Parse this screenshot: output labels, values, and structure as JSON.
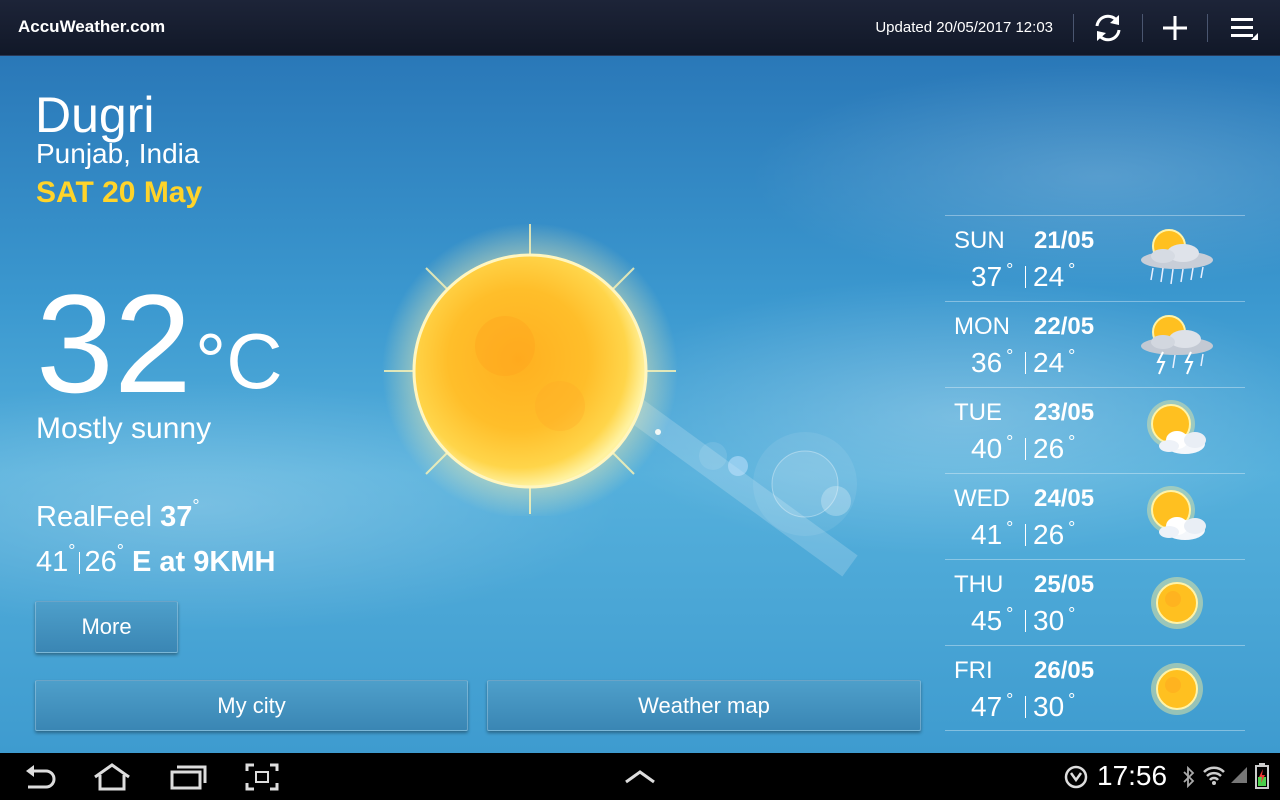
{
  "topbar": {
    "brand": "AccuWeather.com",
    "updated": "Updated 20/05/2017 12:03",
    "icons": [
      "refresh-icon",
      "add-icon",
      "menu-icon"
    ]
  },
  "current": {
    "city": "Dugri",
    "region": "Punjab, India",
    "date": "SAT 20 May",
    "temperature": "32",
    "unit": "°C",
    "condition": "Mostly sunny",
    "realfeel_label": "RealFeel",
    "realfeel_value": "37",
    "high": "41",
    "low": "26",
    "wind": "E at 9KMH",
    "degree": "°"
  },
  "buttons": {
    "more": "More",
    "my_city": "My city",
    "weather_map": "Weather map"
  },
  "forecast": [
    {
      "day": "SUN",
      "date": "21/05",
      "high": "37",
      "low": "24",
      "icon": "sun-cloud-rain-icon"
    },
    {
      "day": "MON",
      "date": "22/05",
      "high": "36",
      "low": "24",
      "icon": "sun-cloud-thunderstorm-icon"
    },
    {
      "day": "TUE",
      "date": "23/05",
      "high": "40",
      "low": "26",
      "icon": "sun-cloud-icon"
    },
    {
      "day": "WED",
      "date": "24/05",
      "high": "41",
      "low": "26",
      "icon": "sun-cloud-icon"
    },
    {
      "day": "THU",
      "date": "25/05",
      "high": "45",
      "low": "30",
      "icon": "sun-icon"
    },
    {
      "day": "FRI",
      "date": "26/05",
      "high": "47",
      "low": "30",
      "icon": "sun-icon"
    }
  ],
  "statusbar": {
    "clock": "17:56",
    "icons": [
      "back-icon",
      "home-icon",
      "recent-apps-icon",
      "screenshot-icon",
      "up-arrow-icon",
      "usb-debug-icon",
      "bluetooth-icon",
      "wifi-icon",
      "signal-icon",
      "battery-icon"
    ]
  },
  "colors": {
    "accent_date": "#ffd42a",
    "topbar": "#161d2f",
    "sky": "#3b98cf"
  }
}
